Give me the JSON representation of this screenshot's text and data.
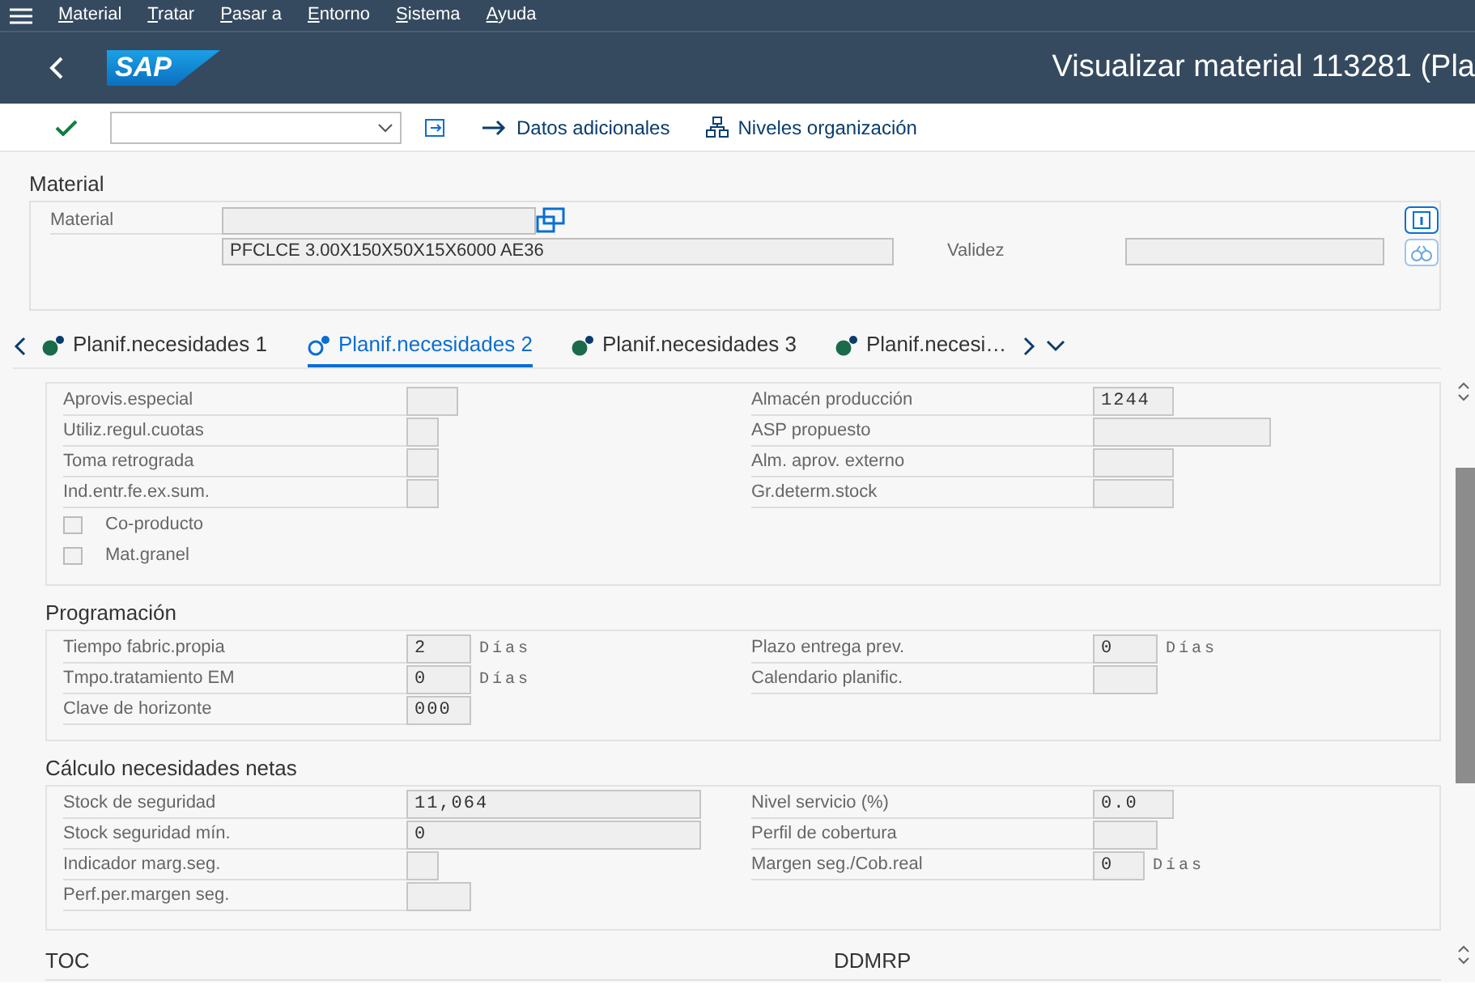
{
  "menu_bar": [
    "Material",
    "Tratar",
    "Pasar a",
    "Entorno",
    "Sistema",
    "Ayuda"
  ],
  "header": {
    "logo": "SAP",
    "title": "Visualizar material 113281 (Pla"
  },
  "toolbar": {
    "buttons": [
      {
        "kind": "arrow",
        "label": "Datos adicionales"
      },
      {
        "kind": "org",
        "label": "Niveles organización"
      }
    ]
  },
  "material": {
    "title": "Material",
    "label": "Material",
    "description": "PFCLCE 3.00X150X50X15X6000 AE36",
    "validity_label": "Validez"
  },
  "tabs": [
    {
      "label": "Planif.necesidades 1",
      "selected": false
    },
    {
      "label": "Planif.necesidades 2",
      "selected": true
    },
    {
      "label": "Planif.necesidades 3",
      "selected": false
    },
    {
      "label": "Planif.necesi…",
      "selected": false
    }
  ],
  "sections": [
    {
      "rows": [
        {
          "left": {
            "kind": "field",
            "label": "Aprovis.especial"
          },
          "right": {
            "kind": "field",
            "label": "Almacén producción",
            "value": "1244"
          }
        },
        {
          "left": {
            "kind": "field",
            "label": "Utiliz.regul.cuotas"
          },
          "right": {
            "kind": "field",
            "label": "ASP propuesto"
          }
        },
        {
          "left": {
            "kind": "field",
            "label": "Toma retrograda"
          },
          "right": {
            "kind": "field",
            "label": "Alm. aprov. externo"
          }
        },
        {
          "left": {
            "kind": "field",
            "label": "Ind.entr.fe.ex.sum."
          },
          "right": {
            "kind": "field",
            "label": "Gr.determ.stock"
          }
        },
        {
          "left": {
            "kind": "checkbox",
            "label": "Co-producto",
            "checked": false
          }
        },
        {
          "left": {
            "kind": "checkbox",
            "label": "Mat.granel",
            "checked": false
          }
        }
      ]
    },
    {
      "title": "Programación",
      "rows": [
        {
          "left": {
            "kind": "field",
            "label": "Tiempo fabric.propia",
            "value": "2",
            "unit": "Días"
          },
          "right": {
            "kind": "field",
            "label": "Plazo entrega prev.",
            "value": "0",
            "unit": "Días"
          }
        },
        {
          "left": {
            "kind": "field",
            "label": "Tmpo.tratamiento EM",
            "value": "0",
            "unit": "Días"
          },
          "right": {
            "kind": "field",
            "label": "Calendario planific."
          }
        },
        {
          "left": {
            "kind": "field",
            "label": "Clave de horizonte",
            "value": "000"
          }
        }
      ]
    },
    {
      "title": "Cálculo necesidades netas",
      "rows": [
        {
          "left": {
            "kind": "field",
            "label": "Stock de seguridad",
            "value": "11,064"
          },
          "right": {
            "kind": "field",
            "label": "Nivel servicio (%)",
            "value": "0.0"
          }
        },
        {
          "left": {
            "kind": "field",
            "label": "Stock seguridad mín.",
            "value": "0"
          },
          "right": {
            "kind": "field",
            "label": "Perfil de cobertura"
          }
        },
        {
          "left": {
            "kind": "field",
            "label": "Indicador marg.seg."
          },
          "right": {
            "kind": "field",
            "label": "Margen seg./Cob.real",
            "value": "0",
            "unit": "Días"
          }
        },
        {
          "left": {
            "kind": "field",
            "label": "Perf.per.margen seg."
          }
        }
      ]
    }
  ],
  "bottom_titles": [
    "TOC",
    "DDMRP"
  ]
}
